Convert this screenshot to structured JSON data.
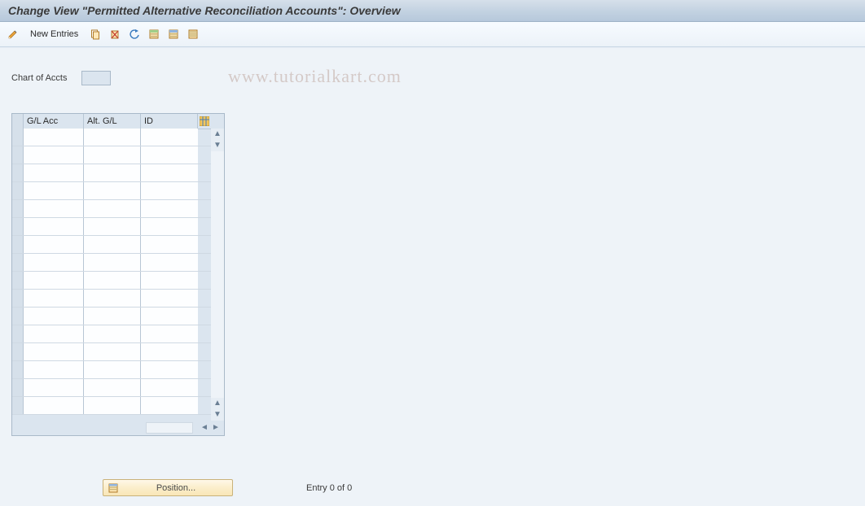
{
  "title": "Change View \"Permitted Alternative Reconciliation Accounts\": Overview",
  "toolbar": {
    "new_entries_label": "New Entries"
  },
  "watermark": "www.tutorialkart.com",
  "field": {
    "chart_of_accts_label": "Chart of Accts",
    "chart_of_accts_value": ""
  },
  "table": {
    "headers": {
      "c1": "G/L Acc",
      "c2": "Alt. G/L",
      "c3": "ID"
    },
    "rows": [
      {
        "gl": "",
        "alt": "",
        "id": ""
      },
      {
        "gl": "",
        "alt": "",
        "id": ""
      },
      {
        "gl": "",
        "alt": "",
        "id": ""
      },
      {
        "gl": "",
        "alt": "",
        "id": ""
      },
      {
        "gl": "",
        "alt": "",
        "id": ""
      },
      {
        "gl": "",
        "alt": "",
        "id": ""
      },
      {
        "gl": "",
        "alt": "",
        "id": ""
      },
      {
        "gl": "",
        "alt": "",
        "id": ""
      },
      {
        "gl": "",
        "alt": "",
        "id": ""
      },
      {
        "gl": "",
        "alt": "",
        "id": ""
      },
      {
        "gl": "",
        "alt": "",
        "id": ""
      },
      {
        "gl": "",
        "alt": "",
        "id": ""
      },
      {
        "gl": "",
        "alt": "",
        "id": ""
      },
      {
        "gl": "",
        "alt": "",
        "id": ""
      },
      {
        "gl": "",
        "alt": "",
        "id": ""
      },
      {
        "gl": "",
        "alt": "",
        "id": ""
      }
    ]
  },
  "footer": {
    "position_label": "Position...",
    "entry_text": "Entry 0 of 0"
  }
}
